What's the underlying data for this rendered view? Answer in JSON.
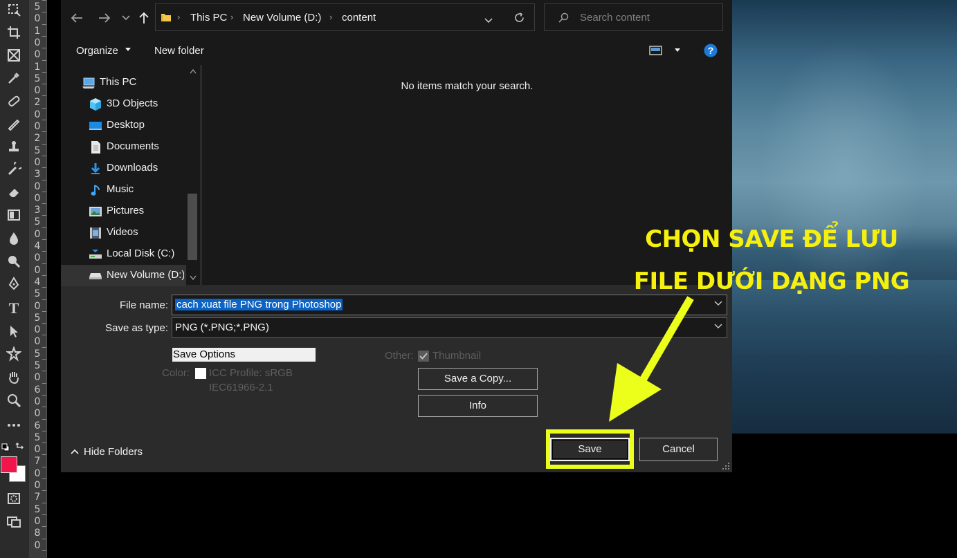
{
  "ruler": {
    "numbers": [
      "5",
      "0",
      "1",
      "0",
      "0",
      "1",
      "5",
      "0",
      "2",
      "0",
      "0",
      "2",
      "5",
      "0",
      "3",
      "0",
      "0",
      "3",
      "5",
      "0",
      "4",
      "0",
      "0",
      "4",
      "5",
      "0",
      "5",
      "0",
      "0",
      "5",
      "5",
      "0",
      "6",
      "0",
      "0",
      "6",
      "5",
      "0",
      "7",
      "0",
      "0",
      "7",
      "5",
      "0",
      "8",
      "0"
    ]
  },
  "address_bar": {
    "back_icon": "arrow-left-icon",
    "forward_icon": "arrow-right-icon",
    "recent_icon": "chevron-down-icon",
    "up_icon": "arrow-up-icon",
    "breadcrumbs": [
      "This PC",
      "New Volume (D:)",
      "content"
    ],
    "search_placeholder": "Search content"
  },
  "command_bar": {
    "organize_label": "Organize",
    "new_folder_label": "New folder"
  },
  "nav_pane": {
    "items": [
      {
        "label": "This PC",
        "icon": "computer-icon"
      },
      {
        "label": "3D Objects",
        "icon": "cube-icon"
      },
      {
        "label": "Desktop",
        "icon": "desktop-icon"
      },
      {
        "label": "Documents",
        "icon": "document-icon"
      },
      {
        "label": "Downloads",
        "icon": "download-icon"
      },
      {
        "label": "Music",
        "icon": "music-note-icon"
      },
      {
        "label": "Pictures",
        "icon": "picture-icon"
      },
      {
        "label": "Videos",
        "icon": "video-icon"
      },
      {
        "label": "Local Disk (C:)",
        "icon": "drive-icon"
      },
      {
        "label": "New Volume (D:)",
        "icon": "drive-icon"
      }
    ]
  },
  "file_list": {
    "empty_message": "No items match your search."
  },
  "form": {
    "file_name_label": "File name:",
    "file_name_value": "cach xuat file PNG trong Photoshop",
    "save_as_type_label": "Save as type:",
    "save_as_type_value": "PNG (*.PNG;*.PNG)"
  },
  "options": {
    "save_options_label": "Save Options",
    "color_label": "Color:",
    "icc_profile_label": "ICC Profile:  sRGB",
    "icc_profile_detail": "IEC61966-2.1",
    "other_label": "Other:",
    "thumbnail_label": "Thumbnail",
    "save_copy_label": "Save a Copy...",
    "info_label": "Info"
  },
  "footer": {
    "hide_folders_label": "Hide Folders",
    "save_label": "Save",
    "cancel_label": "Cancel"
  },
  "annotation": {
    "line1": "CHỌN SAVE ĐỂ LƯU",
    "line2": "FILE DƯỚI DẠNG PNG"
  },
  "colors": {
    "foreground_swatch": "#f0154a",
    "background_swatch": "#ffffff",
    "annotation": "#f5f00f",
    "selection": "#0b63c5"
  }
}
